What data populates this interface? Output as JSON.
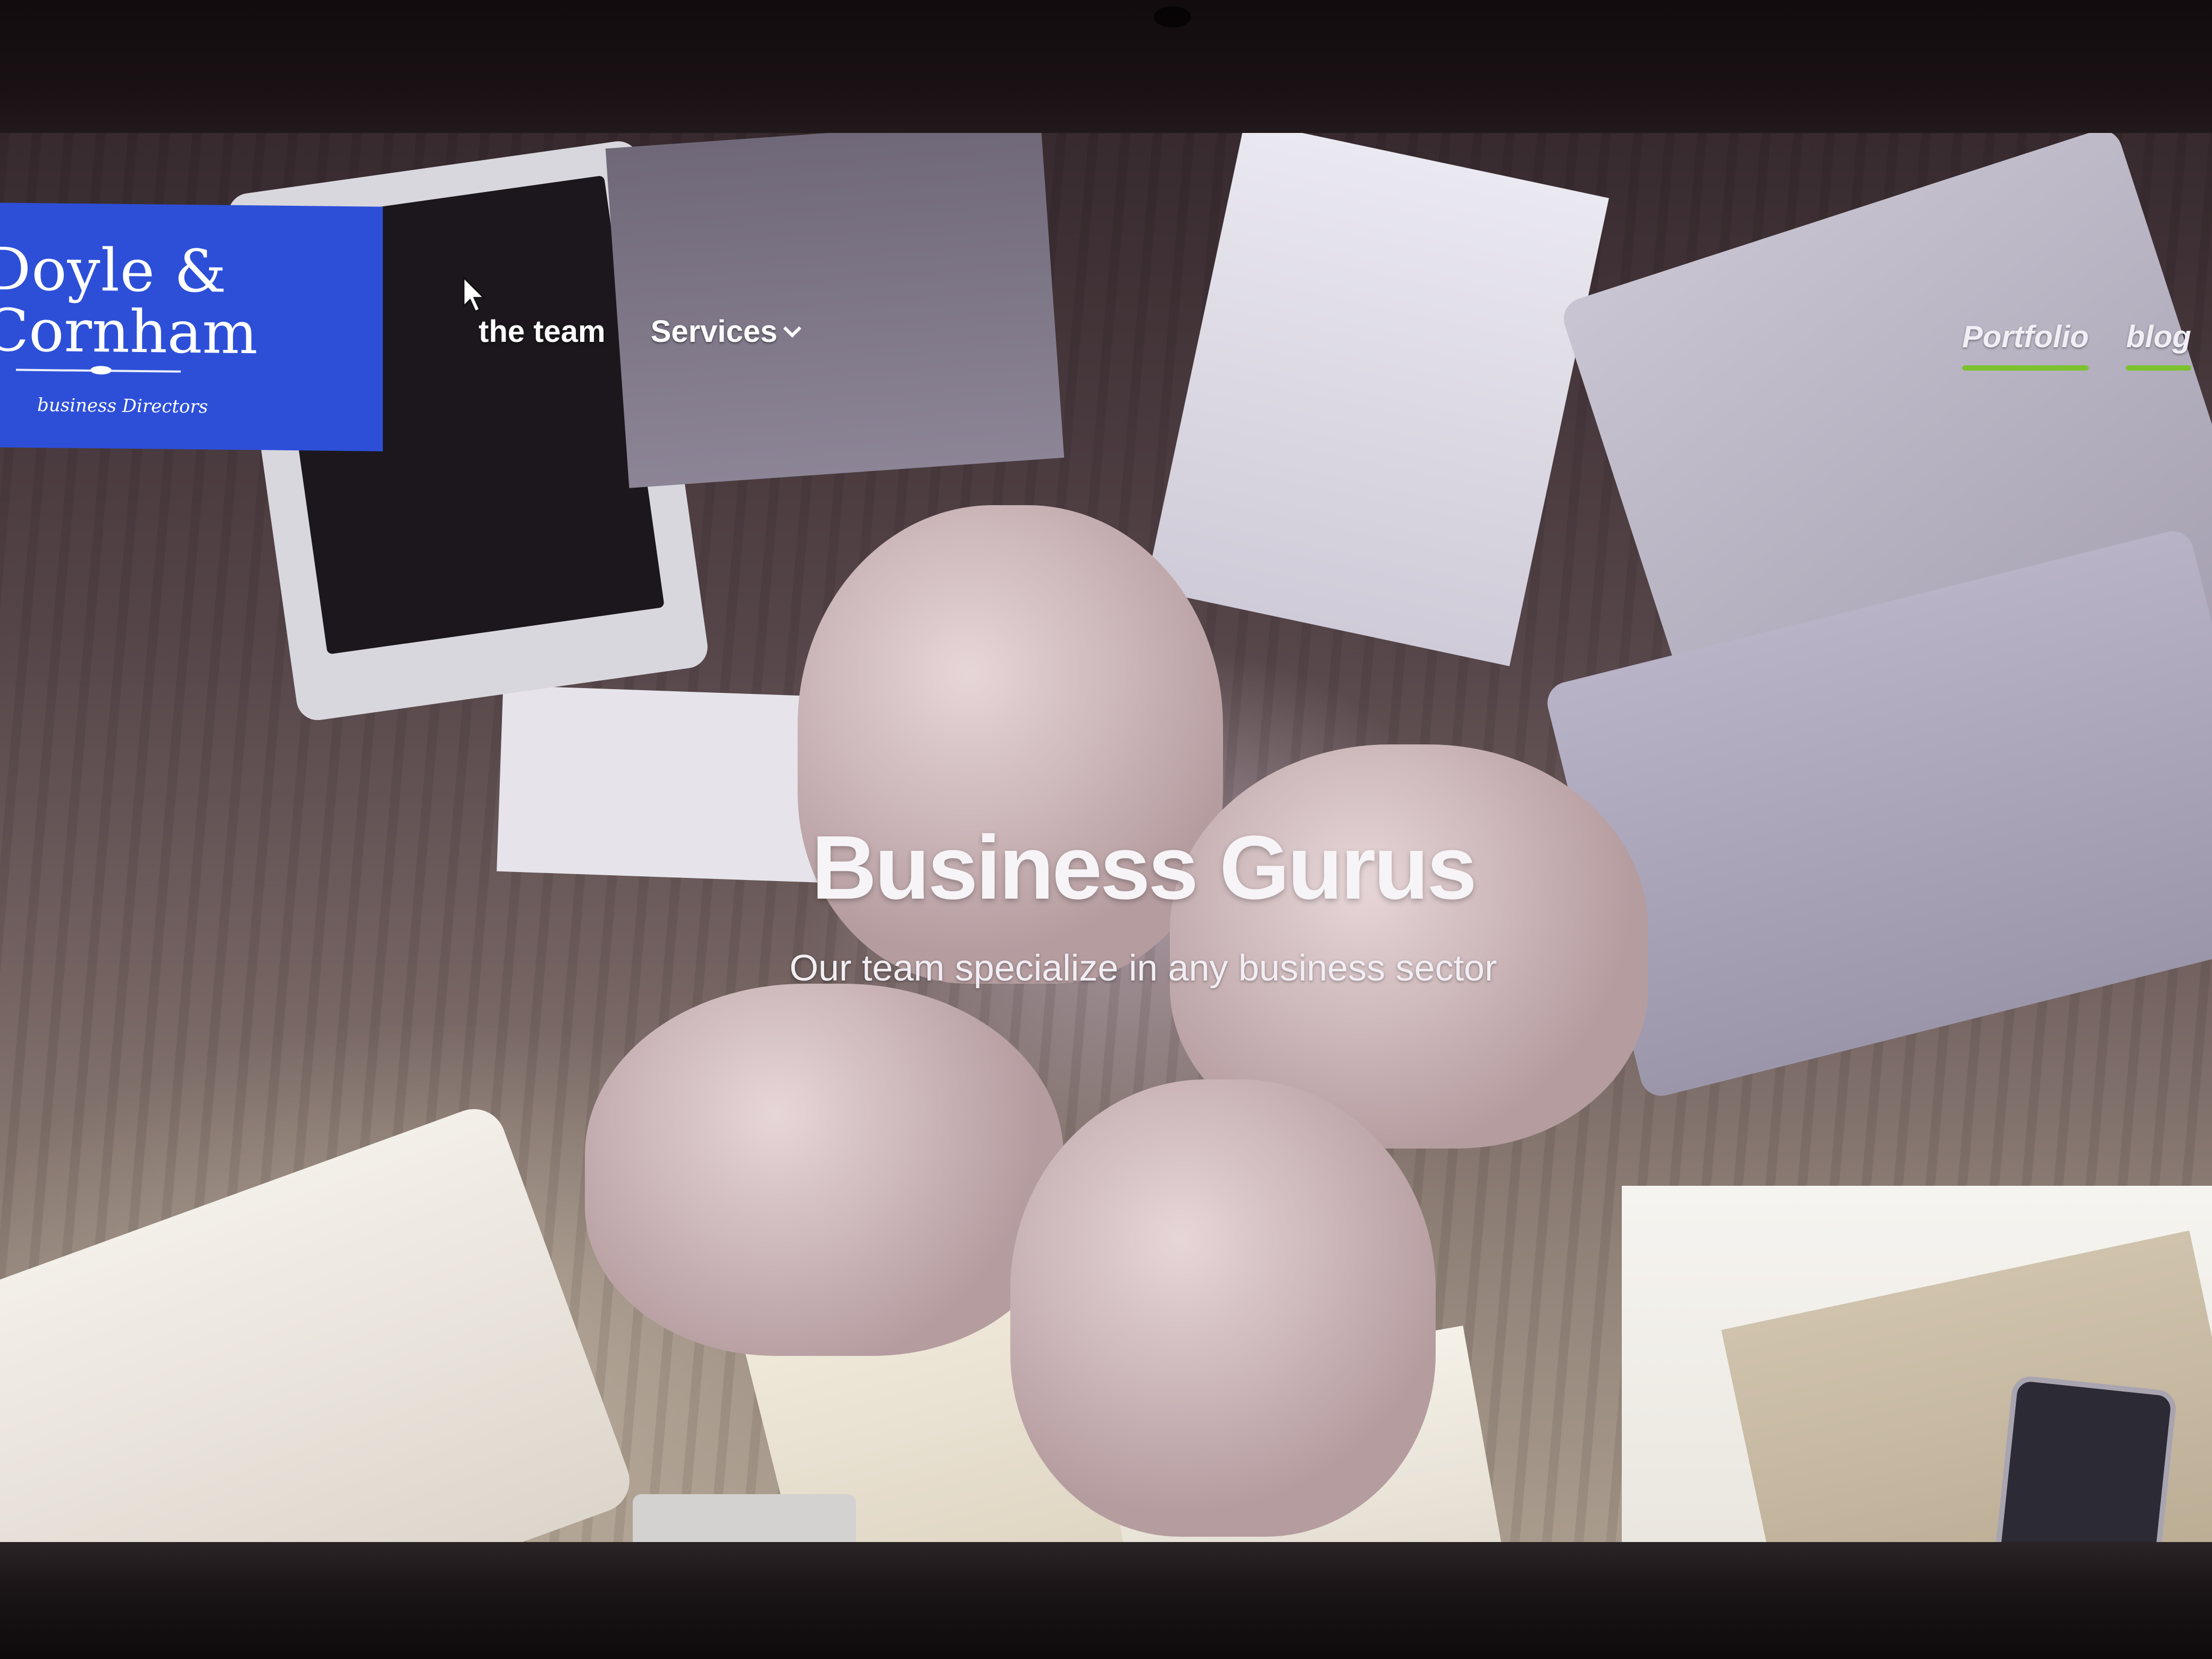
{
  "logo": {
    "line1": "Doyle &",
    "line2": "Cornham",
    "tagline": "business Directors"
  },
  "nav": {
    "left": [
      {
        "label": "the team"
      },
      {
        "label": "Services"
      }
    ],
    "right": [
      {
        "label": "Portfolio"
      },
      {
        "label": "blog"
      }
    ]
  },
  "hero": {
    "title": "Business Gurus",
    "subtitle": "Our team specialize in any business sector"
  },
  "colors": {
    "logo_bg": "#2d4fd8",
    "nav_underline": "#7cc22e",
    "text": "#ffffff"
  },
  "icons": {
    "services_dropdown": "chevron-down-icon",
    "cursor": "mouse-pointer-icon"
  }
}
